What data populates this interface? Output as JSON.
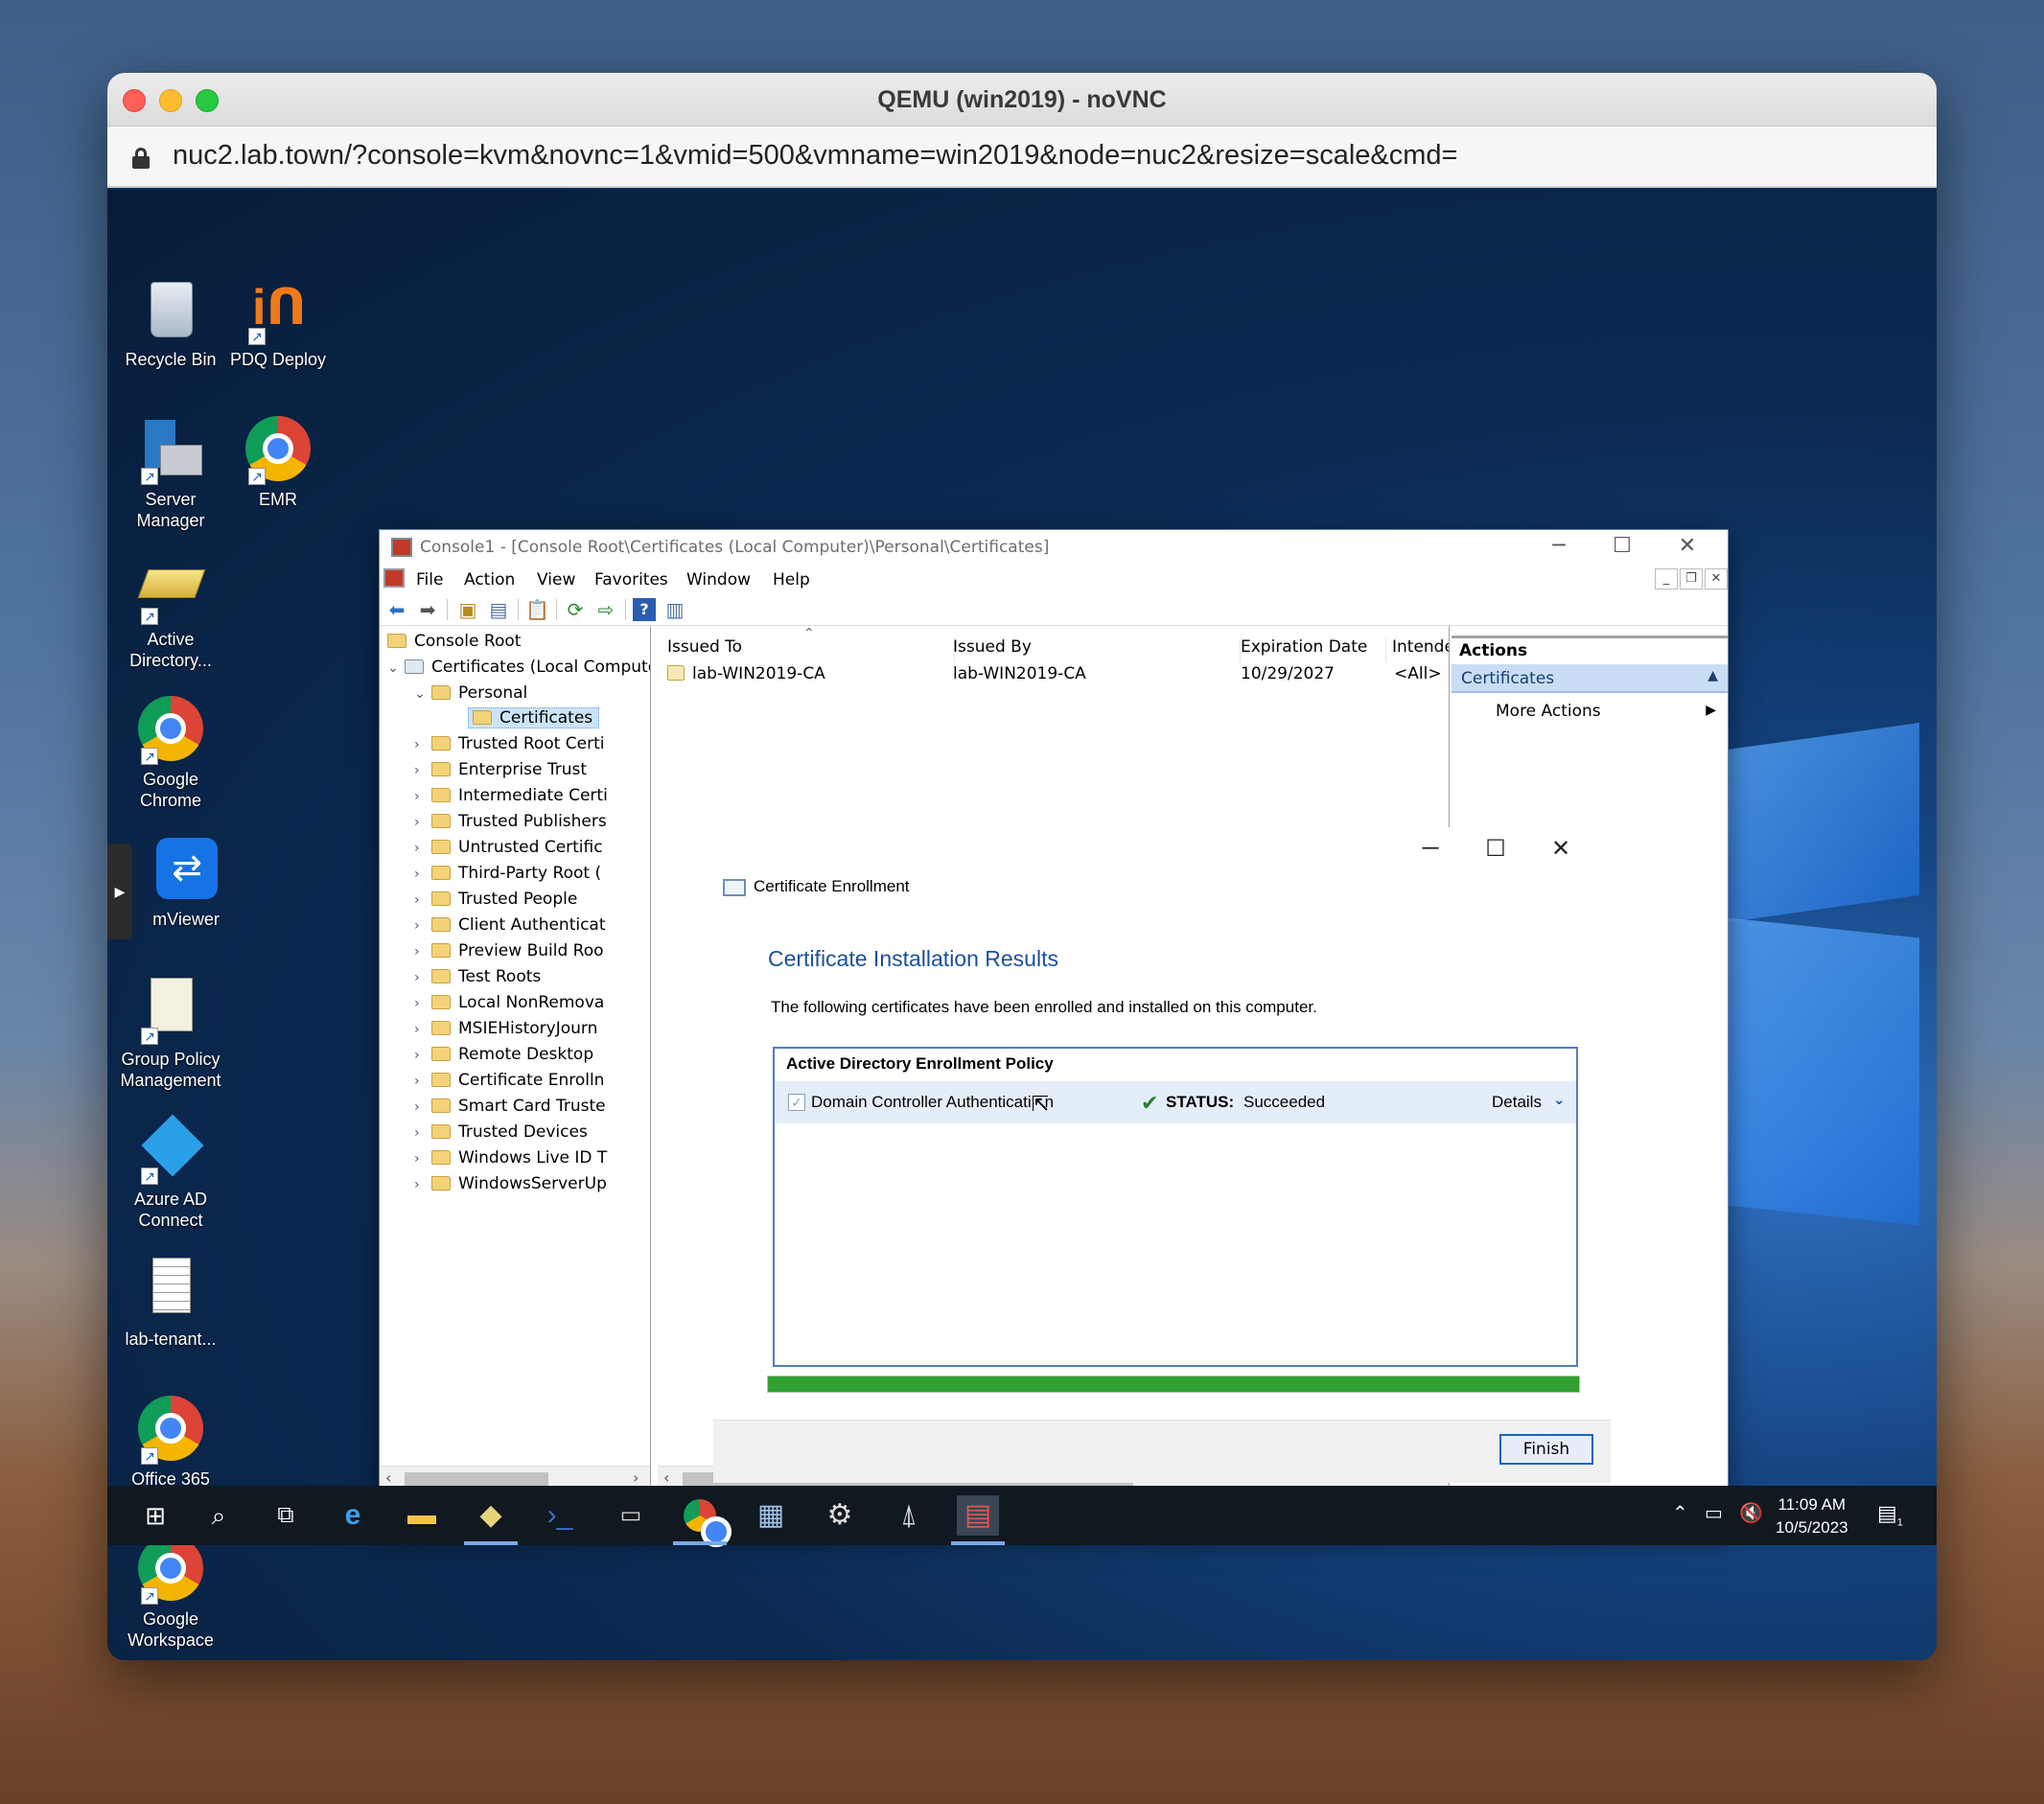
{
  "browser": {
    "title": "QEMU (win2019) - noVNC",
    "url": "nuc2.lab.town/?console=kvm&novnc=1&vmid=500&vmname=win2019&node=nuc2&resize=scale&cmd="
  },
  "desktop_icons": [
    {
      "label": "Recycle Bin",
      "icon": "recycle-bin-icon"
    },
    {
      "label": "PDQ Deploy",
      "icon": "pdq-deploy-icon"
    },
    {
      "label": "Server Manager",
      "icon": "server-manager-icon"
    },
    {
      "label": "EMR",
      "icon": "chrome-icon"
    },
    {
      "label": "Active Directory...",
      "icon": "active-directory-icon"
    },
    {
      "label": "Google Chrome",
      "icon": "chrome-icon"
    },
    {
      "label": "mViewer",
      "icon": "teamviewer-icon"
    },
    {
      "label": "Group Policy Management",
      "icon": "group-policy-icon"
    },
    {
      "label": "Azure AD Connect",
      "icon": "azure-ad-icon"
    },
    {
      "label": "lab-tenant...",
      "icon": "document-icon"
    },
    {
      "label": "Office 365",
      "icon": "chrome-icon"
    },
    {
      "label": "Google Workspace",
      "icon": "chrome-icon"
    }
  ],
  "mmc": {
    "title": "Console1 - [Console Root\\Certificates (Local Computer)\\Personal\\Certificates]",
    "menu": [
      "File",
      "Action",
      "View",
      "Favorites",
      "Window",
      "Help"
    ],
    "tree": {
      "root": "Console Root",
      "certificates": "Certificates (Local Compute",
      "personal": "Personal",
      "selected": "Certificates",
      "stores": [
        "Trusted Root Certi",
        "Enterprise Trust",
        "Intermediate Certi",
        "Trusted Publishers",
        "Untrusted Certific",
        "Third-Party Root (",
        "Trusted People",
        "Client Authenticat",
        "Preview Build Roo",
        "Test Roots",
        "Local NonRemova",
        "MSIEHistoryJourn",
        "Remote Desktop",
        "Certificate Enrolln",
        "Smart Card Truste",
        "Trusted Devices",
        "Windows Live ID T",
        "WindowsServerUp"
      ]
    },
    "columns": [
      "Issued To",
      "Issued By",
      "Expiration Date",
      "Intendec"
    ],
    "rows": [
      {
        "issued_to": "lab-WIN2019-CA",
        "issued_by": "lab-WIN2019-CA",
        "expiration": "10/29/2027",
        "intended": "<All>"
      }
    ],
    "actions": {
      "header": "Actions",
      "section": "Certificates",
      "more": "More Actions"
    }
  },
  "dialog": {
    "title": "Certificate Enrollment",
    "heading": "Certificate Installation Results",
    "description": "The following certificates have been enrolled and installed on this computer.",
    "policy": "Active Directory Enrollment Policy",
    "certificate": "Domain Controller Authenticati",
    "certificate_tail": "n",
    "status_label": "STATUS:",
    "status_value": "Succeeded",
    "details": "Details",
    "progress": 1.0,
    "finish": "Finish"
  },
  "taskbar": {
    "time": "11:09 AM",
    "date": "10/5/2023",
    "notifications": "1"
  },
  "colors": {
    "accent": "#1b4f9c",
    "success": "#30a030",
    "selection": "#cce4f7"
  }
}
